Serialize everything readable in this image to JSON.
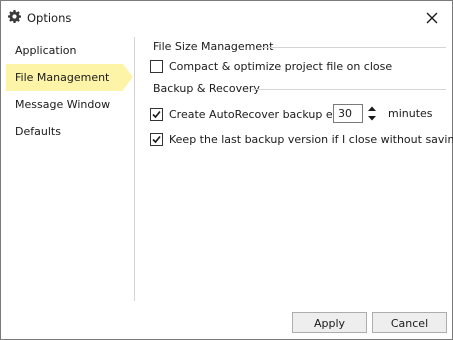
{
  "window": {
    "title": "Options",
    "icon": "gear-icon",
    "close_icon": "close-icon"
  },
  "sidebar": {
    "items": [
      {
        "label": "Application",
        "active": false
      },
      {
        "label": "File Management",
        "active": true
      },
      {
        "label": "Message Window",
        "active": false
      },
      {
        "label": "Defaults",
        "active": false
      }
    ],
    "active_color": "#fdf4a8"
  },
  "sections": {
    "file_size": {
      "title": "File Size Management",
      "compact_label": "Compact & optimize project file on close",
      "compact_checked": false
    },
    "backup": {
      "title": "Backup & Recovery",
      "autorecover_label": "Create AutoRecover backup every",
      "autorecover_checked": true,
      "autorecover_minutes": "30",
      "minutes_label": "minutes",
      "keep_last_label": "Keep the last backup version if I close without saving",
      "keep_last_checked": true
    }
  },
  "buttons": {
    "apply_label": "Apply",
    "cancel_label": "Cancel"
  }
}
